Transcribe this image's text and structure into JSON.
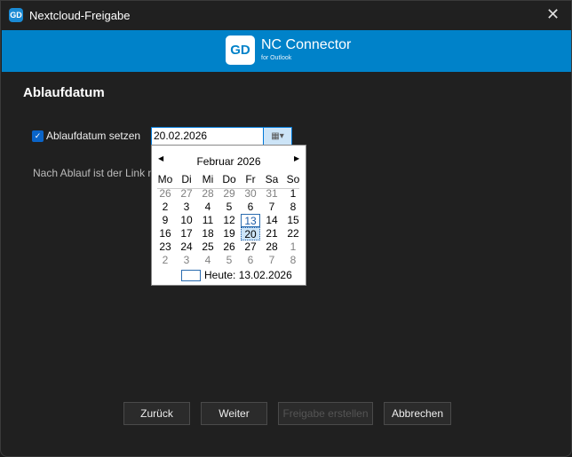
{
  "window": {
    "title": "Nextcloud-Freigabe",
    "close_icon": "close-icon"
  },
  "banner": {
    "brand": "NC Connector",
    "subtitle": "for Outlook",
    "accent": "#0082c9"
  },
  "heading": "Ablaufdatum",
  "expiry": {
    "checkbox_label": "Ablaufdatum setzen",
    "checked": true,
    "date_value": "20.02.2026",
    "hint": "Nach Ablauf ist der Link nic"
  },
  "calendar": {
    "month_label": "Februar 2026",
    "weekdays": [
      "Mo",
      "Di",
      "Mi",
      "Do",
      "Fr",
      "Sa",
      "So"
    ],
    "weeks": [
      [
        "26",
        "27",
        "28",
        "29",
        "30",
        "31",
        "1"
      ],
      [
        "2",
        "3",
        "4",
        "5",
        "6",
        "7",
        "8"
      ],
      [
        "9",
        "10",
        "11",
        "12",
        "13",
        "14",
        "15"
      ],
      [
        "16",
        "17",
        "18",
        "19",
        "20",
        "21",
        "22"
      ],
      [
        "23",
        "24",
        "25",
        "26",
        "27",
        "28",
        "1"
      ],
      [
        "2",
        "3",
        "4",
        "5",
        "6",
        "7",
        "8"
      ]
    ],
    "today_day": "13",
    "selected_day": "20",
    "today_label": "Heute: 13.02.2026"
  },
  "buttons": {
    "back": "Zurück",
    "next": "Weiter",
    "create": "Freigabe erstellen",
    "cancel": "Abbrechen"
  }
}
